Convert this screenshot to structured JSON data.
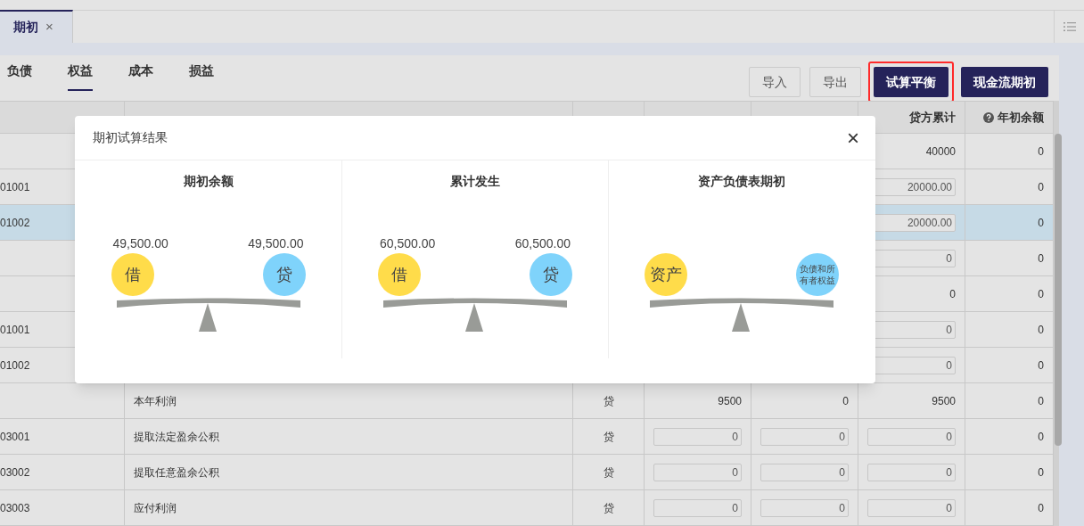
{
  "tabs": [
    {
      "label": "期初",
      "selected": true,
      "close": "×"
    }
  ],
  "subtabs": [
    {
      "label": "负债",
      "selected": false
    },
    {
      "label": "权益",
      "selected": true
    },
    {
      "label": "成本",
      "selected": false
    },
    {
      "label": "损益",
      "selected": false
    }
  ],
  "buttons": [
    {
      "label": "导入",
      "kind": "outline",
      "highlighted": false
    },
    {
      "label": "导出",
      "kind": "outline",
      "highlighted": false
    },
    {
      "label": "试算平衡",
      "kind": "primary",
      "highlighted": true
    },
    {
      "label": "现金流期初",
      "kind": "primary",
      "highlighted": false
    }
  ],
  "table": {
    "columns": [
      {},
      {},
      {},
      {},
      {},
      {
        "label": "贷方累计"
      },
      {
        "label": "年初余额",
        "help": true
      }
    ],
    "rows": [
      {
        "selected": false,
        "cells": [
          "",
          "",
          "",
          "",
          "",
          "40000",
          "0"
        ]
      },
      {
        "selected": false,
        "cells": [
          "01001",
          "",
          "",
          "",
          "",
          {
            "text": "20000.00",
            "kind": "input"
          },
          "0"
        ]
      },
      {
        "selected": true,
        "cells": [
          "01002",
          "",
          "",
          "",
          "",
          {
            "text": "20000.00",
            "kind": "input"
          },
          "0"
        ]
      },
      {
        "selected": false,
        "cells": [
          "",
          "",
          "",
          "",
          "",
          {
            "text": "0",
            "kind": "input"
          },
          "0"
        ]
      },
      {
        "selected": false,
        "cells": [
          "",
          "",
          "",
          "",
          "",
          "0",
          "0"
        ]
      },
      {
        "selected": false,
        "cells": [
          "01001",
          "",
          "",
          "",
          "",
          {
            "text": "0",
            "kind": "input"
          },
          "0"
        ]
      },
      {
        "selected": false,
        "cells": [
          "01002",
          "",
          "",
          "",
          "",
          {
            "text": "0",
            "kind": "input"
          },
          "0"
        ]
      },
      {
        "selected": false,
        "cells": [
          "",
          "本年利润",
          "贷",
          "9500",
          "0",
          "9500",
          "0"
        ]
      },
      {
        "selected": false,
        "cells": [
          "03001",
          "提取法定盈余公积",
          "贷",
          {
            "text": "0",
            "kind": "input"
          },
          {
            "text": "0",
            "kind": "input"
          },
          {
            "text": "0",
            "kind": "input"
          },
          "0"
        ]
      },
      {
        "selected": false,
        "cells": [
          "03002",
          "提取任意盈余公积",
          "贷",
          {
            "text": "0",
            "kind": "input"
          },
          {
            "text": "0",
            "kind": "input"
          },
          {
            "text": "0",
            "kind": "input"
          },
          "0"
        ]
      },
      {
        "selected": false,
        "cells": [
          "03003",
          "应付利润",
          "贷",
          {
            "text": "0",
            "kind": "input"
          },
          {
            "text": "0",
            "kind": "input"
          },
          {
            "text": "0",
            "kind": "input"
          },
          "0"
        ]
      }
    ]
  },
  "dialog": {
    "title": "期初试算结果",
    "close": "×",
    "panels": [
      {
        "title": "期初余额",
        "left_amount": "49,500.00",
        "right_amount": "49,500.00",
        "left_label": "借",
        "right_label": "贷"
      },
      {
        "title": "累计发生",
        "left_amount": "60,500.00",
        "right_amount": "60,500.00",
        "left_label": "借",
        "right_label": "贷"
      },
      {
        "title": "资产负债表期初",
        "left_label": "资产",
        "right_label": "负债和所有者权益"
      }
    ]
  }
}
